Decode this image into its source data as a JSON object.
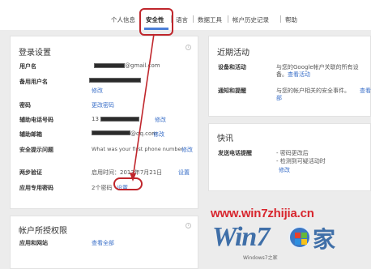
{
  "tabs": [
    {
      "label": "个人信息",
      "active": false
    },
    {
      "label": "安全性",
      "active": true
    },
    {
      "label": "语言",
      "active": false
    },
    {
      "label": "数据工具",
      "active": false
    },
    {
      "label": "帐户历史记录",
      "active": false
    },
    {
      "label": "帮助",
      "active": false
    }
  ],
  "login": {
    "title": "登录设置",
    "username_label": "用户名",
    "username_suffix": "@gmail.com",
    "backup_label": "备用用户名",
    "backup_link": "修改",
    "password_label": "密码",
    "password_link": "更改密码",
    "phone_label": "辅助电话号码",
    "phone_prefix": "13",
    "phone_link": "修改",
    "email_label": "辅助邮箱",
    "email_suffix": "@qq.com",
    "email_link": "修改",
    "question_label": "安全提示问题",
    "question_value": "What was your first phone number",
    "question_link": "修改",
    "twostep_label": "两步验证",
    "twostep_value": "启用时间：2013年7月21日",
    "twostep_link": "设置",
    "apppw_label": "应用专用密码",
    "apppw_value": "2个密码",
    "apppw_link": "设置"
  },
  "activity": {
    "title": "近期活动",
    "devices_label": "设备和活动",
    "devices_text_1": "与您的Google帐户关联的所有设",
    "devices_text_2": "备。",
    "devices_link": "查看活动",
    "notif_label": "通知和提醒",
    "notif_text": "与您的帐户相关的安全事件。",
    "notif_link_1": "查看",
    "notif_link_2": "部"
  },
  "quick": {
    "title": "快讯",
    "alerts_label": "发送电话提醒",
    "alerts_item_1": "- 密码更改后",
    "alerts_item_2": "- 检测到可疑活动时",
    "alerts_link": "修改"
  },
  "permissions": {
    "title": "帐户所授权限",
    "apps_label": "应用和网站",
    "apps_link": "查看全部"
  },
  "watermark": {
    "url": "www.win7zhijia.cn",
    "logo_word": "Win7",
    "logo_suffix": "家",
    "tag": "Windows7之家"
  },
  "colors": {
    "link": "#3a6fc8",
    "annotation": "#c0262c",
    "tab_underline": "#4a7fd8"
  }
}
